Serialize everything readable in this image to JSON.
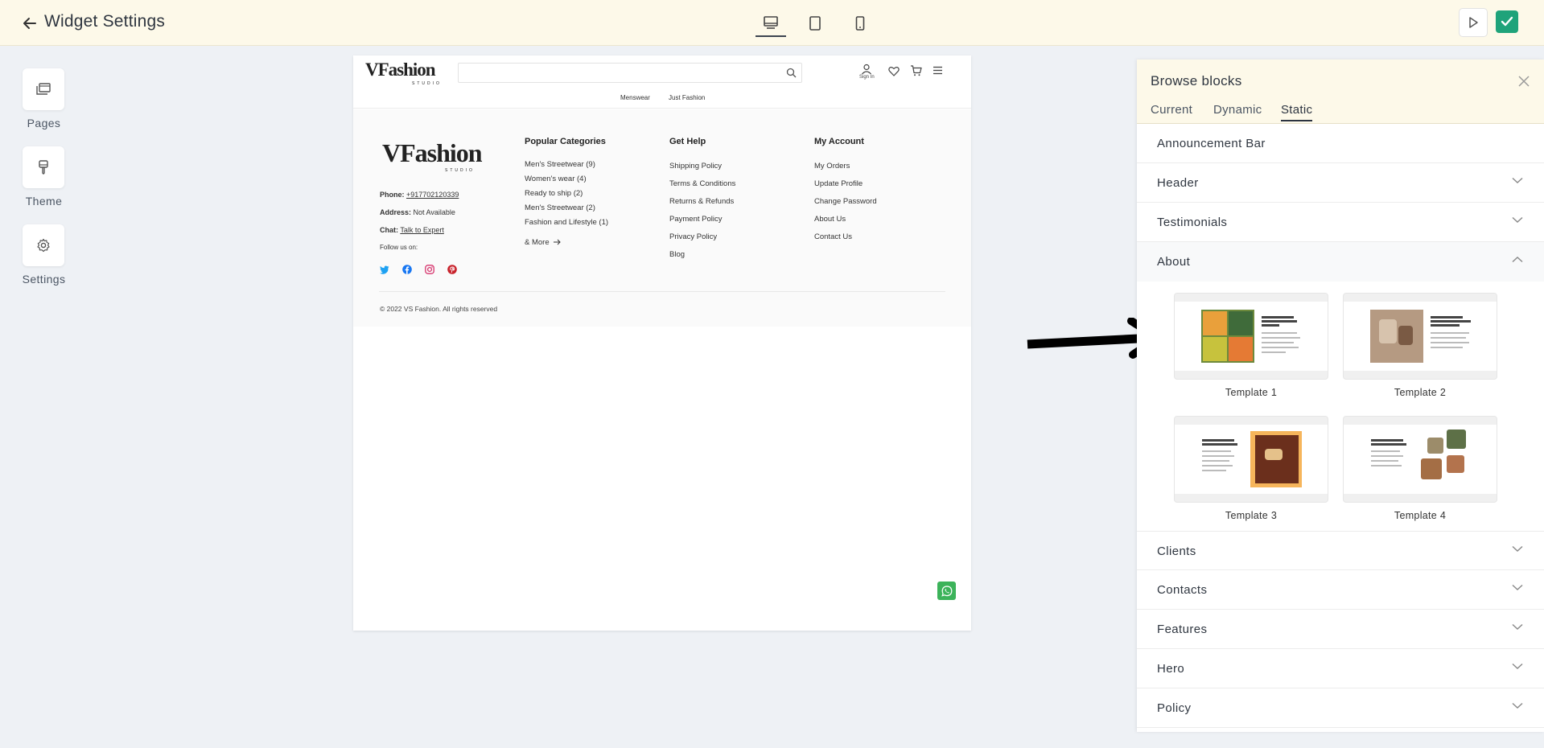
{
  "topbar": {
    "title": "Widget Settings",
    "device_icons": [
      "desktop-icon",
      "tablet-icon",
      "mobile-icon"
    ],
    "active_device": "desktop",
    "accent": "#1fa37a"
  },
  "rail": {
    "pages_label": "Pages",
    "theme_label": "Theme",
    "settings_label": "Settings"
  },
  "site": {
    "logo_main": "VFashion",
    "logo_sub": "STUDIO",
    "search_placeholder": "",
    "signin_label": "Sign In",
    "nav": [
      "Menswear",
      "Just Fashion"
    ],
    "footer": {
      "phone_label": "Phone:",
      "phone_value": "+917702120339",
      "address_label": "Address:",
      "address_value": "Not Available",
      "chat_label": "Chat:",
      "chat_value": "Talk to Expert",
      "follow_label": "Follow us on:",
      "social_icons": [
        "twitter-icon",
        "facebook-icon",
        "instagram-icon",
        "pinterest-icon"
      ],
      "popular_title": "Popular Categories",
      "popular": [
        "Men's Streetwear (9)",
        "Women's wear (4)",
        "Ready to ship (2)",
        "Men's Streetwear (2)",
        "Fashion and Lifestyle (1)"
      ],
      "more_label": "& More",
      "help_title": "Get Help",
      "help": [
        "Shipping Policy",
        "Terms & Conditions",
        "Returns & Refunds",
        "Payment Policy",
        "Privacy Policy",
        "Blog"
      ],
      "account_title": "My Account",
      "account": [
        "My Orders",
        "Update Profile",
        "Change Password",
        "About Us",
        "Contact Us"
      ],
      "copyright": "© 2022 VS Fashion. All rights reserved"
    }
  },
  "panel": {
    "title": "Browse blocks",
    "tabs": [
      "Current",
      "Dynamic",
      "Static"
    ],
    "active_tab": "Static",
    "rows_top": [
      "Announcement Bar",
      "Header",
      "Testimonials",
      "About"
    ],
    "open_row": "About",
    "templates": [
      "Template 1",
      "Template 2",
      "Template 3",
      "Template 4"
    ],
    "rows_bottom": [
      "Clients",
      "Contacts",
      "Features",
      "Hero",
      "Policy"
    ]
  }
}
